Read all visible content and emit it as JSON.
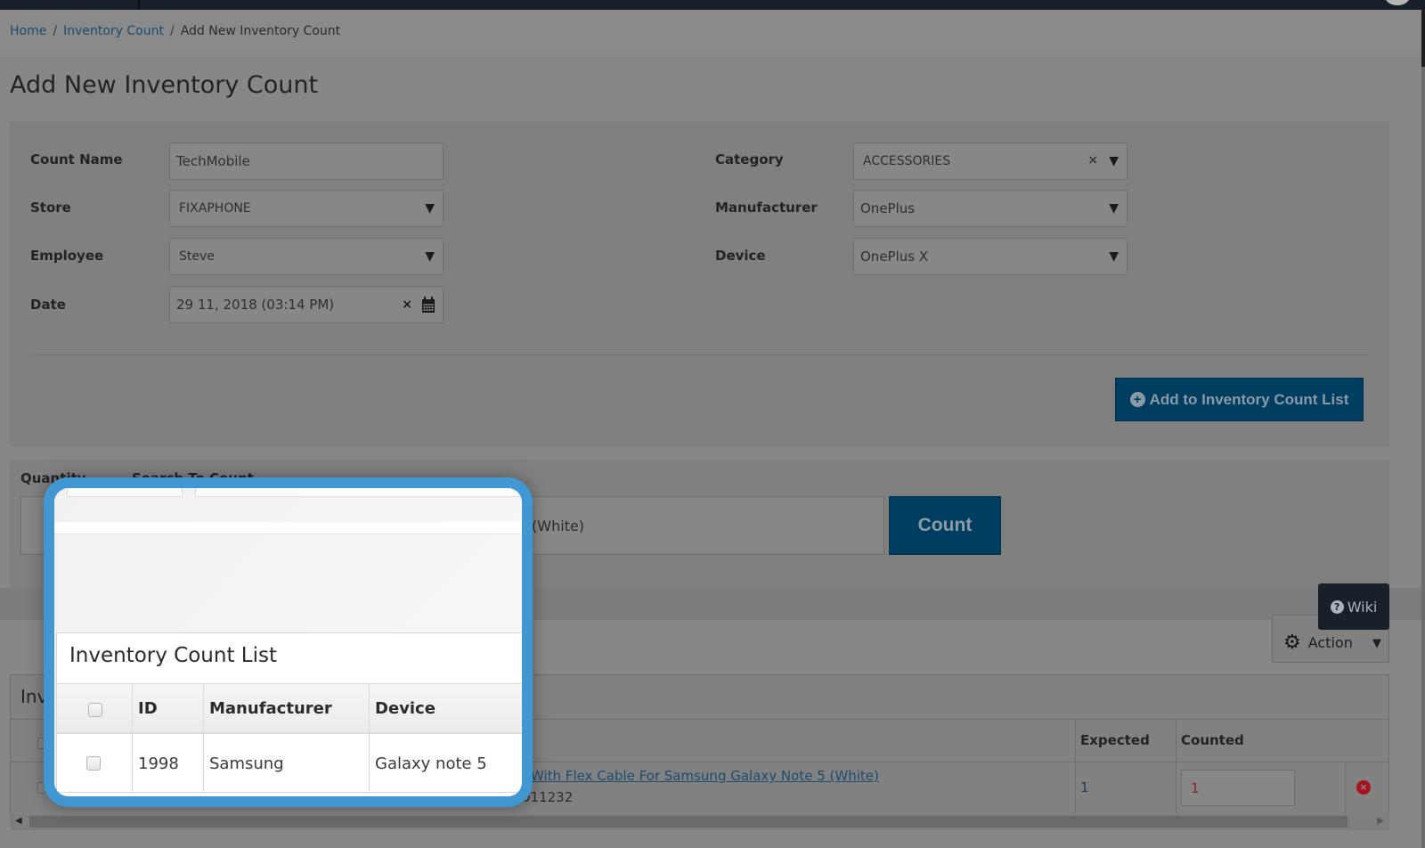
{
  "breadcrumb": [
    {
      "label": "Home"
    },
    {
      "label": "Inventory Count"
    },
    {
      "label": "Add New Inventory Count"
    }
  ],
  "page_title": "Add New Inventory Count",
  "form": {
    "count_name": {
      "label": "Count Name",
      "value": "TechMobile"
    },
    "store": {
      "label": "Store",
      "value": "FIXAPHONE"
    },
    "employee": {
      "label": "Employee",
      "value": "Steve"
    },
    "date": {
      "label": "Date",
      "value": "29 11, 2018 (03:14 PM)"
    },
    "category": {
      "label": "Category",
      "value": "ACCESSORIES"
    },
    "manufacturer": {
      "label": "Manufacturer",
      "value": "OnePlus"
    },
    "device": {
      "label": "Device",
      "value": "OnePlus X"
    }
  },
  "add_button": "Add to Inventory Count List",
  "count_section": {
    "quantity_label": "Quantity",
    "search_label": "Search To Count",
    "search_value_visible": "(White)",
    "count_button": "Count"
  },
  "wiki_button": "Wiki",
  "action_button": "Action",
  "inventory_list": {
    "title": "Inventory Count List",
    "columns": [
      "",
      "ID",
      "Manufacturer",
      "Device",
      "",
      "Expected",
      "Counted",
      ""
    ],
    "rows": [
      {
        "id": "1998",
        "manufacturer": "Samsung",
        "device": "Galaxy note 5",
        "product_visible": "With Flex Cable For Samsung Galaxy Note 5 (White)",
        "sku_visible": "011232",
        "expected": "1",
        "counted": "1"
      }
    ]
  },
  "icons": {
    "dropdown": "▼",
    "clear": "×",
    "calendar": "calendar-icon",
    "plus": "+",
    "question": "?",
    "gear": "⚙",
    "remove": "×"
  },
  "colors": {
    "primary": "#003e61",
    "callout_border": "#4097d2",
    "link": "#1d4c6f",
    "danger": "#a8121f"
  }
}
